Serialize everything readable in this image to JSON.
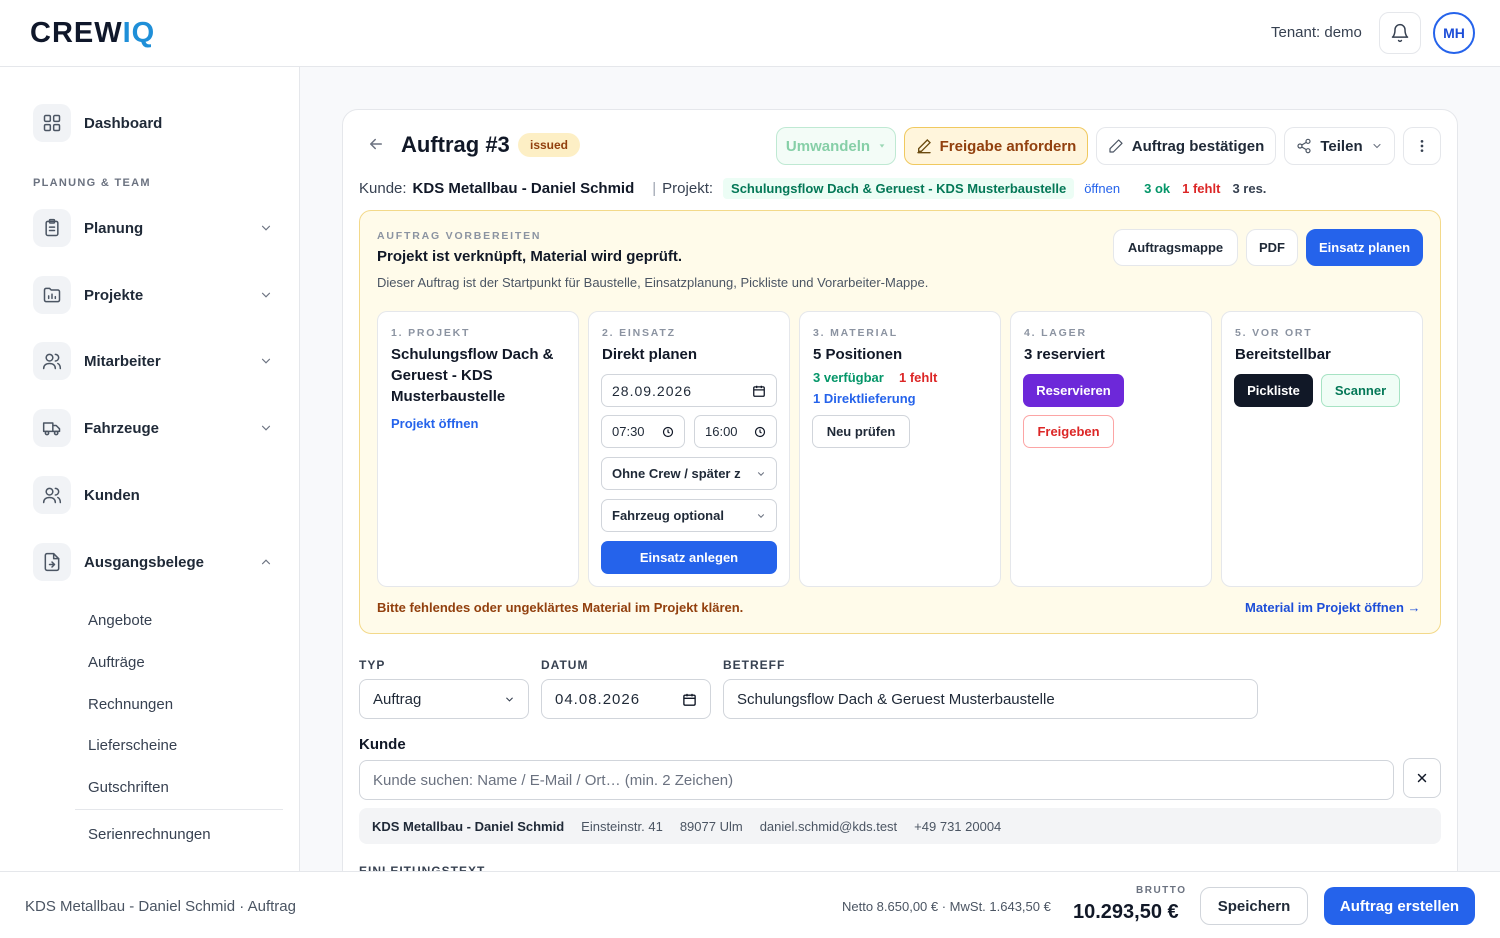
{
  "header": {
    "logo_main": "CREW",
    "logo_accent": "IQ",
    "tenant": "Tenant: demo",
    "avatar_initials": "MH",
    "accent_color": "#2563eb"
  },
  "sidebar": {
    "dashboard": "Dashboard",
    "section_planning": "PLANUNG & TEAM",
    "items": [
      "Planung",
      "Projekte",
      "Mitarbeiter",
      "Fahrzeuge",
      "Kunden",
      "Ausgangsbelege"
    ],
    "subitems": [
      "Angebote",
      "Aufträge",
      "Rechnungen",
      "Lieferscheine",
      "Gutschriften"
    ],
    "subitems2": [
      "Serienrechnungen"
    ]
  },
  "order": {
    "title": "Auftrag #3",
    "status": "issued",
    "btn_convert": "Umwandeln",
    "btn_request": "Freigabe anfordern",
    "btn_confirm": "Auftrag bestätigen",
    "btn_share": "Teilen",
    "customer_label": "Kunde:",
    "customer": "KDS Metallbau - Daniel Schmid",
    "separator": "|",
    "project_label": "Projekt:",
    "project": "Schulungsflow Dach & Geruest - KDS Musterbaustelle",
    "open_link": "öffnen",
    "ok_count": "3 ok",
    "missing_count": "1 fehlt",
    "reserved_count": "3 res."
  },
  "prepare": {
    "kicker": "AUFTRAG VORBEREITEN",
    "headline": "Projekt ist verknüpft, Material wird geprüft.",
    "desc": "Dieser Auftrag ist der Startpunkt für Baustelle, Einsatzplanung, Pickliste und Vorarbeiter-Mappe.",
    "btn_folder": "Auftragsmappe",
    "btn_pdf": "PDF",
    "btn_plan": "Einsatz planen",
    "warning": "Bitte fehlendes oder ungeklärtes Material im Projekt klären.",
    "material_link": "Material im Projekt öffnen →",
    "steps": {
      "project": {
        "kicker": "1. PROJEKT",
        "title": "Schulungsflow Dach & Geruest - KDS Musterbaustelle",
        "link": "Projekt öffnen"
      },
      "deploy": {
        "kicker": "2. EINSATZ",
        "title": "Direkt planen",
        "date": "28.09.2026",
        "time_from": "07:30",
        "time_to": "16:00",
        "crew": "Ohne Crew / später z",
        "vehicle": "Fahrzeug optional",
        "btn": "Einsatz anlegen"
      },
      "material": {
        "kicker": "3. MATERIAL",
        "title": "5 Positionen",
        "available": "3 verfügbar",
        "missing": "1 fehlt",
        "direct": "1 Direktlieferung",
        "btn": "Neu prüfen"
      },
      "stock": {
        "kicker": "4. LAGER",
        "title": "3 reserviert",
        "btn_reserve": "Reservieren",
        "btn_release": "Freigeben"
      },
      "onsite": {
        "kicker": "5. VOR ORT",
        "title": "Bereitstellbar",
        "btn_pick": "Pickliste",
        "btn_scan": "Scanner"
      }
    }
  },
  "form": {
    "type_label": "TYP",
    "type_value": "Auftrag",
    "date_label": "DATUM",
    "date_value": "04.08.2026",
    "subject_label": "BETREFF",
    "subject_value": "Schulungsflow Dach & Geruest Musterbaustelle",
    "customer_label": "Kunde",
    "customer_placeholder": "Kunde suchen: Name / E-Mail / Ort… (min. 2 Zeichen)",
    "customer_name": "KDS Metallbau - Daniel Schmid",
    "customer_street": "Einsteinstr. 41",
    "customer_city": "89077 Ulm",
    "customer_email": "daniel.schmid@kds.test",
    "customer_phone": "+49 731 20004",
    "intro_label": "EINLEITUNGSTEXT"
  },
  "footer": {
    "context": "KDS Metallbau - Daniel Schmid · Auftrag",
    "net_tax": "Netto 8.650,00 € · MwSt. 1.643,50 €",
    "gross_label": "BRUTTO",
    "gross_value": "10.293,50 €",
    "btn_save": "Speichern",
    "btn_create": "Auftrag erstellen"
  }
}
